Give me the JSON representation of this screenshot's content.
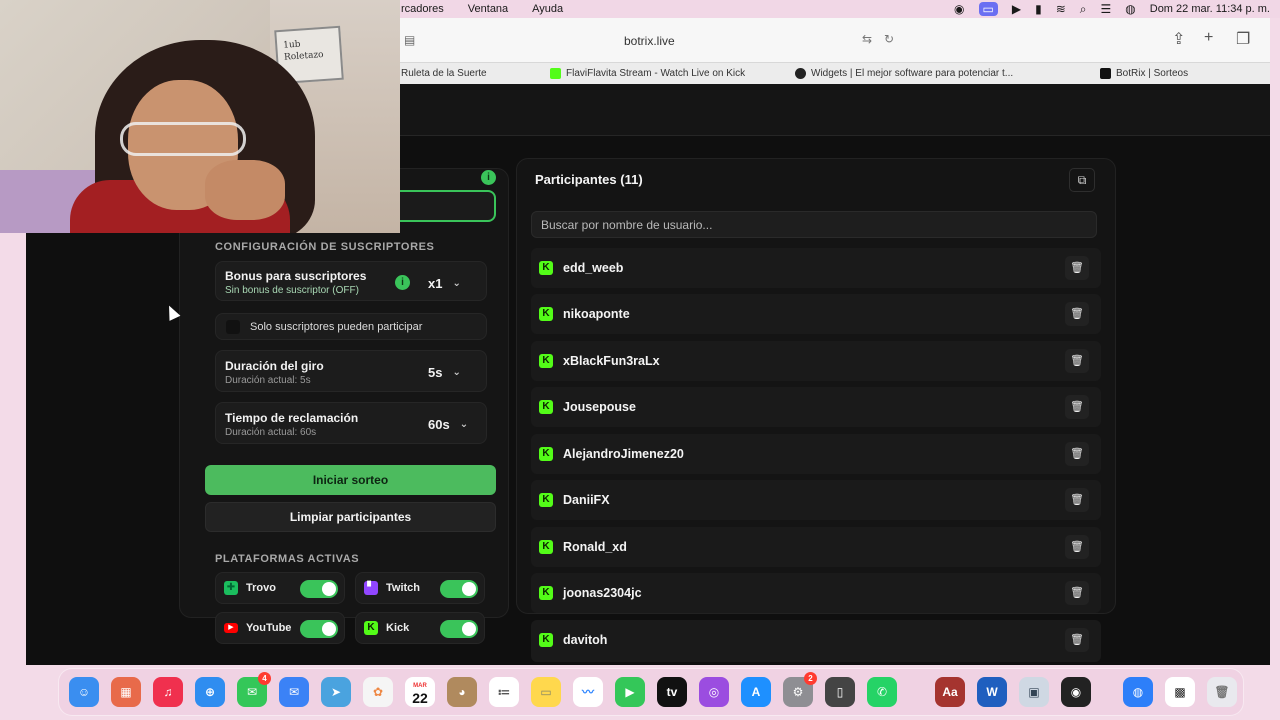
{
  "menubar": {
    "items": [
      "rcadores",
      "Ventana",
      "Ayuda"
    ],
    "datetime": "Dom 22 mar.  11:34 p. m."
  },
  "browser": {
    "url": "botrix.live",
    "tabs": [
      {
        "label": "Ruleta de la Suerte"
      },
      {
        "label": "FlaviFlavita Stream - Watch Live on Kick"
      },
      {
        "label": "Widgets | El mejor software para potenciar t..."
      },
      {
        "label": "BotRix | Sorteos"
      }
    ]
  },
  "webcam": {
    "sign_line1": "1ub",
    "sign_line2": "Roletazo"
  },
  "config": {
    "section_title": "CONFIGURACIÓN DE SUSCRIPTORES",
    "bonus_title": "Bonus para suscriptores",
    "bonus_sub": "Sin bonus de suscriptor (OFF)",
    "bonus_value": "x1",
    "only_subs": "Solo suscriptores pueden participar",
    "spin_title": "Duración del giro",
    "spin_sub": "Duración actual: 5s",
    "spin_value": "5s",
    "claim_title": "Tiempo de reclamación",
    "claim_sub": "Duración actual: 60s",
    "claim_value": "60s",
    "start_label": "Iniciar sorteo",
    "clear_label": "Limpiar participantes",
    "platforms_title": "PLATAFORMAS ACTIVAS",
    "platforms": [
      {
        "name": "Trovo",
        "color": "#1bbd5e"
      },
      {
        "name": "Twitch",
        "color": "#9146ff"
      },
      {
        "name": "YouTube",
        "color": "#ff0000"
      },
      {
        "name": "Kick",
        "color": "#53fc18"
      }
    ]
  },
  "participants": {
    "title": "Participantes (11)",
    "search_placeholder": "Buscar por nombre de usuario...",
    "list": [
      {
        "name": "edd_weeb"
      },
      {
        "name": "nikoaponte"
      },
      {
        "name": "xBlackFun3raLx"
      },
      {
        "name": "Jousepouse"
      },
      {
        "name": "AlejandroJimenez20"
      },
      {
        "name": "DaniiFX"
      },
      {
        "name": "Ronald_xd"
      },
      {
        "name": "joonas2304jc"
      },
      {
        "name": "davitoh"
      }
    ]
  },
  "dock": {
    "calendar_month": "MAR",
    "calendar_day": "22",
    "messages_badge": "4",
    "settings_badge": "2",
    "dictionary_label": "Aa",
    "word_label": "W",
    "tv_label": "tv"
  },
  "colors": {
    "accent_green": "#3ac45a",
    "kick_green": "#53fc18",
    "panel_bg": "#151515"
  }
}
